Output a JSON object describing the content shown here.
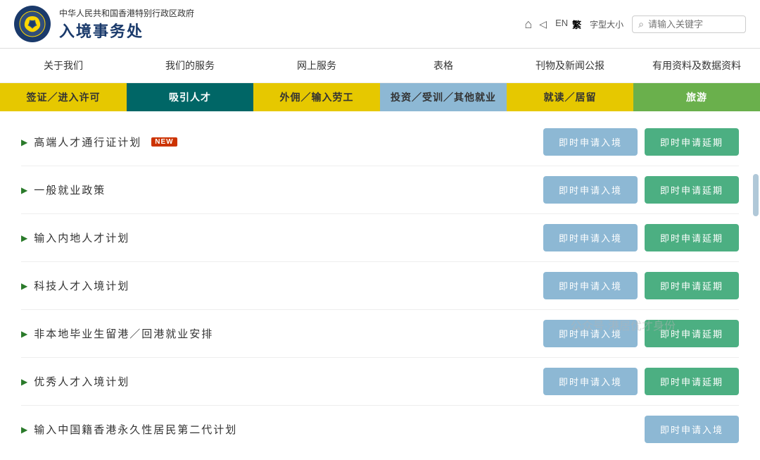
{
  "header": {
    "logo_symbol": "☆",
    "title_top": "中华人民共和国香港特别行政区政府",
    "title_main": "入境事务处",
    "icons": {
      "home": "⌂",
      "share": "◁"
    },
    "lang": [
      "EN",
      "繁"
    ],
    "font_size": "字型大小",
    "search_placeholder": "请输入关键字"
  },
  "main_nav": {
    "items": [
      {
        "label": "关于我们"
      },
      {
        "label": "我们的服务"
      },
      {
        "label": "网上服务"
      },
      {
        "label": "表格"
      },
      {
        "label": "刊物及新闻公报"
      },
      {
        "label": "有用资料及数据资料"
      }
    ]
  },
  "sub_nav": {
    "items": [
      {
        "label": "签证／进入许可",
        "style": "yellow"
      },
      {
        "label": "吸引人才",
        "style": "teal"
      },
      {
        "label": "外佣／输入劳工",
        "style": "yellow"
      },
      {
        "label": "投资／受训／其他就业",
        "style": "light-blue"
      },
      {
        "label": "就读／居留",
        "style": "yellow2"
      },
      {
        "label": "旅游",
        "style": "green-outline"
      }
    ]
  },
  "content": {
    "rows": [
      {
        "title": "高端人才通行证计划",
        "is_new": true,
        "btn_apply": "即时申请入境",
        "btn_extend": "即时申请延期"
      },
      {
        "title": "一般就业政策",
        "is_new": false,
        "btn_apply": "即时申请入境",
        "btn_extend": "即时申请延期"
      },
      {
        "title": "输入内地人才计划",
        "is_new": false,
        "btn_apply": "即时申请入境",
        "btn_extend": "即时申请延期"
      },
      {
        "title": "科技人才入境计划",
        "is_new": false,
        "btn_apply": "即时申请入境",
        "btn_extend": "即时申请延期"
      },
      {
        "title": "非本地毕业生留港／回港就业安排",
        "is_new": false,
        "btn_apply": "即时申请入境",
        "btn_extend": "即时申请延期"
      },
      {
        "title": "优秀人才入境计划",
        "is_new": false,
        "btn_apply": "即时申请入境",
        "btn_extend": "即时申请延期"
      },
      {
        "title": "输入中国籍香港永久性居民第二代计划",
        "is_new": false,
        "btn_apply": "即时申请入境",
        "btn_extend": ""
      }
    ]
  },
  "watermark": "公众号·港居优才身份"
}
